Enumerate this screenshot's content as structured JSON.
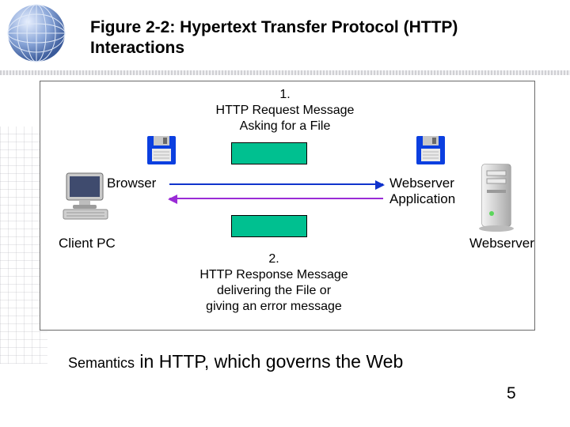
{
  "figure_title": "Figure 2-2: Hypertext Transfer Protocol (HTTP) Interactions",
  "step1": {
    "num": "1.",
    "line1": "HTTP Request Message",
    "line2": "Asking for a File"
  },
  "step2": {
    "num": "2.",
    "line1": "HTTP Response Message",
    "line2": "delivering the File or",
    "line3": "giving an error message"
  },
  "labels": {
    "browser": "Browser",
    "webserver_app": "Webserver Application",
    "client_pc": "Client PC",
    "webserver": "Webserver"
  },
  "caption": {
    "prefix": "Semantics",
    "rest": " in HTTP, which governs the Web"
  },
  "page_number": "5",
  "colors": {
    "box_fill": "#00c090",
    "arrow_request": "#1033cc",
    "arrow_response": "#9a2bd6"
  }
}
